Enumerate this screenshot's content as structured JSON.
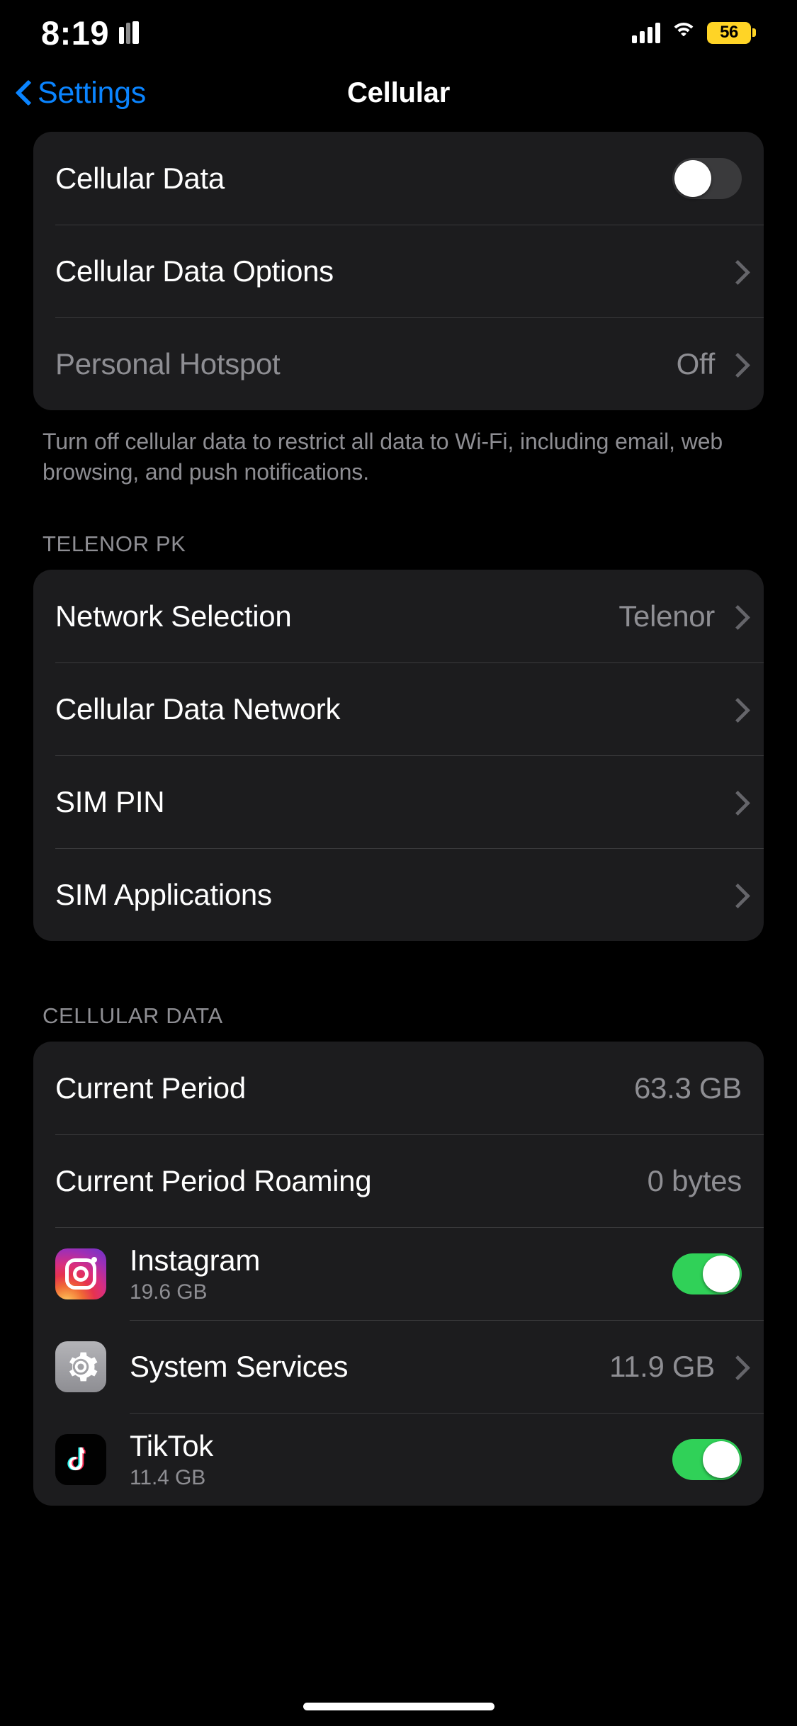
{
  "status_bar": {
    "time": "8:19",
    "books_icon": "books-icon",
    "signal_icon": "cellular-signal-icon",
    "wifi_icon": "wifi-icon",
    "battery_percent": "56",
    "battery_color": "#FFD426"
  },
  "nav": {
    "back_label": "Settings",
    "back_icon": "chevron-left-icon",
    "title": "Cellular"
  },
  "colors": {
    "accent": "#0A84FF",
    "background": "#000000",
    "card": "#1C1C1E",
    "separator": "#3A3A3C",
    "secondary_text": "#8E8E93",
    "toggle_on": "#30D158",
    "toggle_off": "#3A3A3C"
  },
  "section_data": {
    "rows": [
      {
        "label": "Cellular Data",
        "control": "toggle",
        "toggle_state": "off"
      },
      {
        "label": "Cellular Data Options",
        "control": "chevron",
        "value": ""
      },
      {
        "label": "Personal Hotspot",
        "control": "chevron",
        "value": "Off",
        "dimmed": true
      }
    ],
    "footer": "Turn off cellular data to restrict all data to Wi-Fi, including email, web browsing, and push notifications."
  },
  "section_carrier": {
    "header": "TELENOR PK",
    "rows": [
      {
        "label": "Network Selection",
        "value": "Telenor",
        "control": "chevron"
      },
      {
        "label": "Cellular Data Network",
        "value": "",
        "control": "chevron"
      },
      {
        "label": "SIM PIN",
        "value": "",
        "control": "chevron"
      },
      {
        "label": "SIM Applications",
        "value": "",
        "control": "chevron"
      }
    ]
  },
  "section_usage": {
    "header": "CELLULAR DATA",
    "rows": [
      {
        "label": "Current Period",
        "value": "63.3 GB",
        "control": "none"
      },
      {
        "label": "Current Period Roaming",
        "value": "0 bytes",
        "control": "none"
      }
    ],
    "apps": [
      {
        "name": "Instagram",
        "usage": "19.6 GB",
        "icon": "instagram-icon",
        "control": "toggle",
        "toggle_state": "on"
      },
      {
        "name": "System Services",
        "usage": "",
        "value": "11.9 GB",
        "icon": "gear-icon",
        "control": "chevron"
      },
      {
        "name": "TikTok",
        "usage": "11.4 GB",
        "icon": "tiktok-icon",
        "control": "toggle",
        "toggle_state": "on"
      }
    ]
  }
}
